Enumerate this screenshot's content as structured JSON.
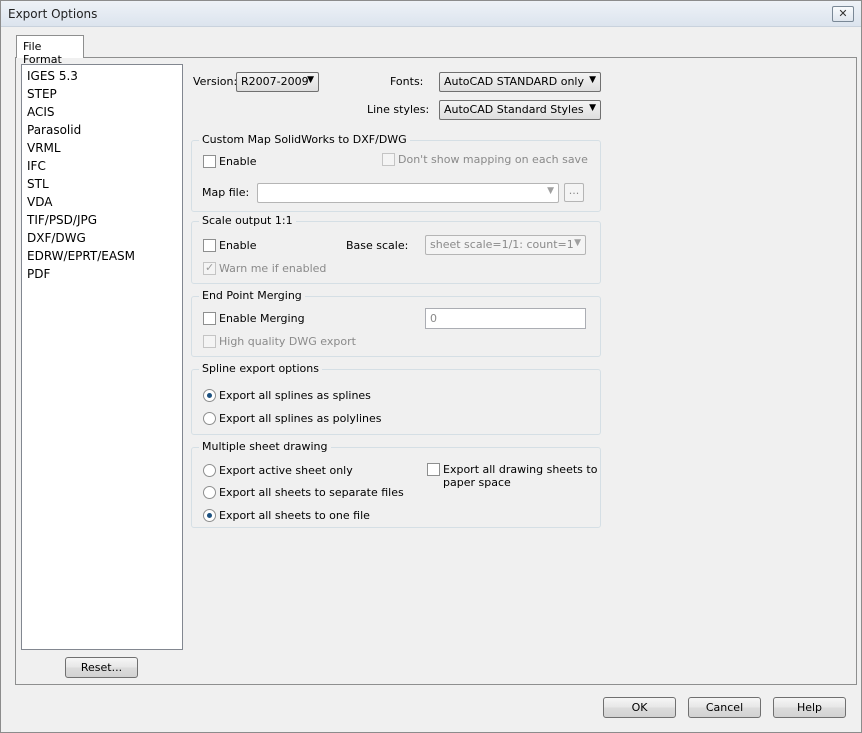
{
  "window": {
    "title": "Export Options",
    "close_glyph": "✕"
  },
  "tab": {
    "label": "File Format"
  },
  "formats": [
    "IGES 5.3",
    "STEP",
    "ACIS",
    "Parasolid",
    "VRML",
    "IFC",
    "STL",
    "VDA",
    "TIF/PSD/JPG",
    "DXF/DWG",
    "EDRW/EPRT/EASM",
    "PDF"
  ],
  "reset_label": "Reset...",
  "version": {
    "label": "Version:",
    "value": "R2007-2009"
  },
  "fonts": {
    "label": "Fonts:",
    "value": "AutoCAD STANDARD only"
  },
  "line_styles": {
    "label": "Line styles:",
    "value": "AutoCAD Standard Styles"
  },
  "custom_map": {
    "title": "Custom Map SolidWorks to DXF/DWG",
    "enable_label": "Enable",
    "enable_checked": false,
    "dont_show_label": "Don't show mapping on each save",
    "map_file_label": "Map file:",
    "map_file_value": "",
    "browse_label": "..."
  },
  "scale_output": {
    "title": "Scale output 1:1",
    "enable_label": "Enable",
    "enable_checked": false,
    "base_scale_label": "Base scale:",
    "base_scale_value": "sheet scale=1/1: count=1",
    "warn_label": "Warn me if enabled",
    "warn_checked": true
  },
  "end_point": {
    "title": "End Point Merging",
    "enable_label": "Enable Merging",
    "enable_checked": false,
    "merge_value": "0",
    "hq_label": "High quality DWG export"
  },
  "spline": {
    "title": "Spline export options",
    "options": [
      "Export all splines as splines",
      "Export all splines as polylines"
    ],
    "selected": "Export all splines as splines"
  },
  "multi_sheet": {
    "title": "Multiple sheet drawing",
    "options": [
      "Export active sheet only",
      "Export all sheets to separate files",
      "Export all sheets to one file"
    ],
    "selected": "Export all sheets to one file",
    "paper_space_label_line1": "Export all drawing sheets to",
    "paper_space_label_line2": "paper space",
    "paper_space_checked": false
  },
  "buttons": {
    "ok": "OK",
    "cancel": "Cancel",
    "help": "Help"
  },
  "combo_arrow": "▼"
}
